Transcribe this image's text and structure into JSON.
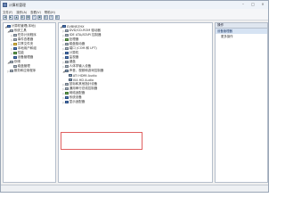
{
  "window": {
    "title": "计算机管理"
  },
  "menubar": {
    "items": [
      "文件(F)",
      "操作(A)",
      "查看(V)",
      "帮助(H)"
    ]
  },
  "left_tree": [
    {
      "label": "计算机管理(本地)",
      "level": 0,
      "expander": "◢",
      "icon": "blue"
    },
    {
      "label": "系统工具",
      "level": 1,
      "expander": "◢",
      "icon": "gray"
    },
    {
      "label": "任务计划程序",
      "level": 2,
      "expander": "▷",
      "icon": "gray"
    },
    {
      "label": "事件查看器",
      "level": 2,
      "expander": "▷",
      "icon": "gray"
    },
    {
      "label": "共享文件夹",
      "level": 2,
      "expander": "▷",
      "icon": "yellow"
    },
    {
      "label": "本地用户和组",
      "level": 2,
      "expander": "▷",
      "icon": "blue"
    },
    {
      "label": "性能",
      "level": 2,
      "expander": "▷",
      "icon": "green"
    },
    {
      "label": "设备管理器",
      "level": 2,
      "expander": "",
      "icon": "blue"
    },
    {
      "label": "存储",
      "level": 1,
      "expander": "◢",
      "icon": "gray"
    },
    {
      "label": "磁盘管理",
      "level": 2,
      "expander": "",
      "icon": "gray"
    },
    {
      "label": "服务和应用程序",
      "level": 1,
      "expander": "▷",
      "icon": "gray"
    }
  ],
  "device_tree": [
    {
      "label": "GVBNEZHX",
      "level": 0,
      "expander": "◢",
      "icon": "blue"
    },
    {
      "label": "DVD/CD-ROM 驱动器",
      "level": 1,
      "expander": "▷",
      "icon": "gray"
    },
    {
      "label": "IDE ATA/ATAPI 控制器",
      "level": 1,
      "expander": "▷",
      "icon": "gray"
    },
    {
      "label": "处理器",
      "level": 1,
      "expander": "▷",
      "icon": "green"
    },
    {
      "label": "磁盘驱动器",
      "level": 1,
      "expander": "▷",
      "icon": "gray"
    },
    {
      "label": "端口 (COM 和 LPT)",
      "level": 1,
      "expander": "▷",
      "icon": "gray"
    },
    {
      "label": "计算机",
      "level": 1,
      "expander": "▷",
      "icon": "blue"
    },
    {
      "label": "监视器",
      "level": 1,
      "expander": "▷",
      "icon": "blue"
    },
    {
      "label": "键盘",
      "level": 1,
      "expander": "▷",
      "icon": "gray"
    },
    {
      "label": "人体学输入设备",
      "level": 1,
      "expander": "▷",
      "icon": "gray"
    },
    {
      "label": "声音、视频和游戏控制器",
      "level": 1,
      "expander": "◢",
      "icon": "speaker"
    },
    {
      "label": "ATI HDMI Audio",
      "level": 2,
      "expander": "",
      "icon": "speaker"
    },
    {
      "label": "VIA HD Audio",
      "level": 2,
      "expander": "",
      "icon": "speaker"
    },
    {
      "label": "鼠标和其他指针设备",
      "level": 1,
      "expander": "▷",
      "icon": "gray"
    },
    {
      "label": "通用串行总线控制器",
      "level": 1,
      "expander": "▷",
      "icon": "gray"
    },
    {
      "label": "网络适配器",
      "level": 1,
      "expander": "▷",
      "icon": "green"
    },
    {
      "label": "系统设备",
      "level": 1,
      "expander": "▷",
      "icon": "blue"
    },
    {
      "label": "显示适配器",
      "level": 1,
      "expander": "▷",
      "icon": "blue"
    }
  ],
  "actions": {
    "header": "操作",
    "section": "设备管理器",
    "items": [
      "更多操作"
    ]
  },
  "colors": {
    "highlight_box": "#e06060",
    "accent": "#4f79b8"
  }
}
